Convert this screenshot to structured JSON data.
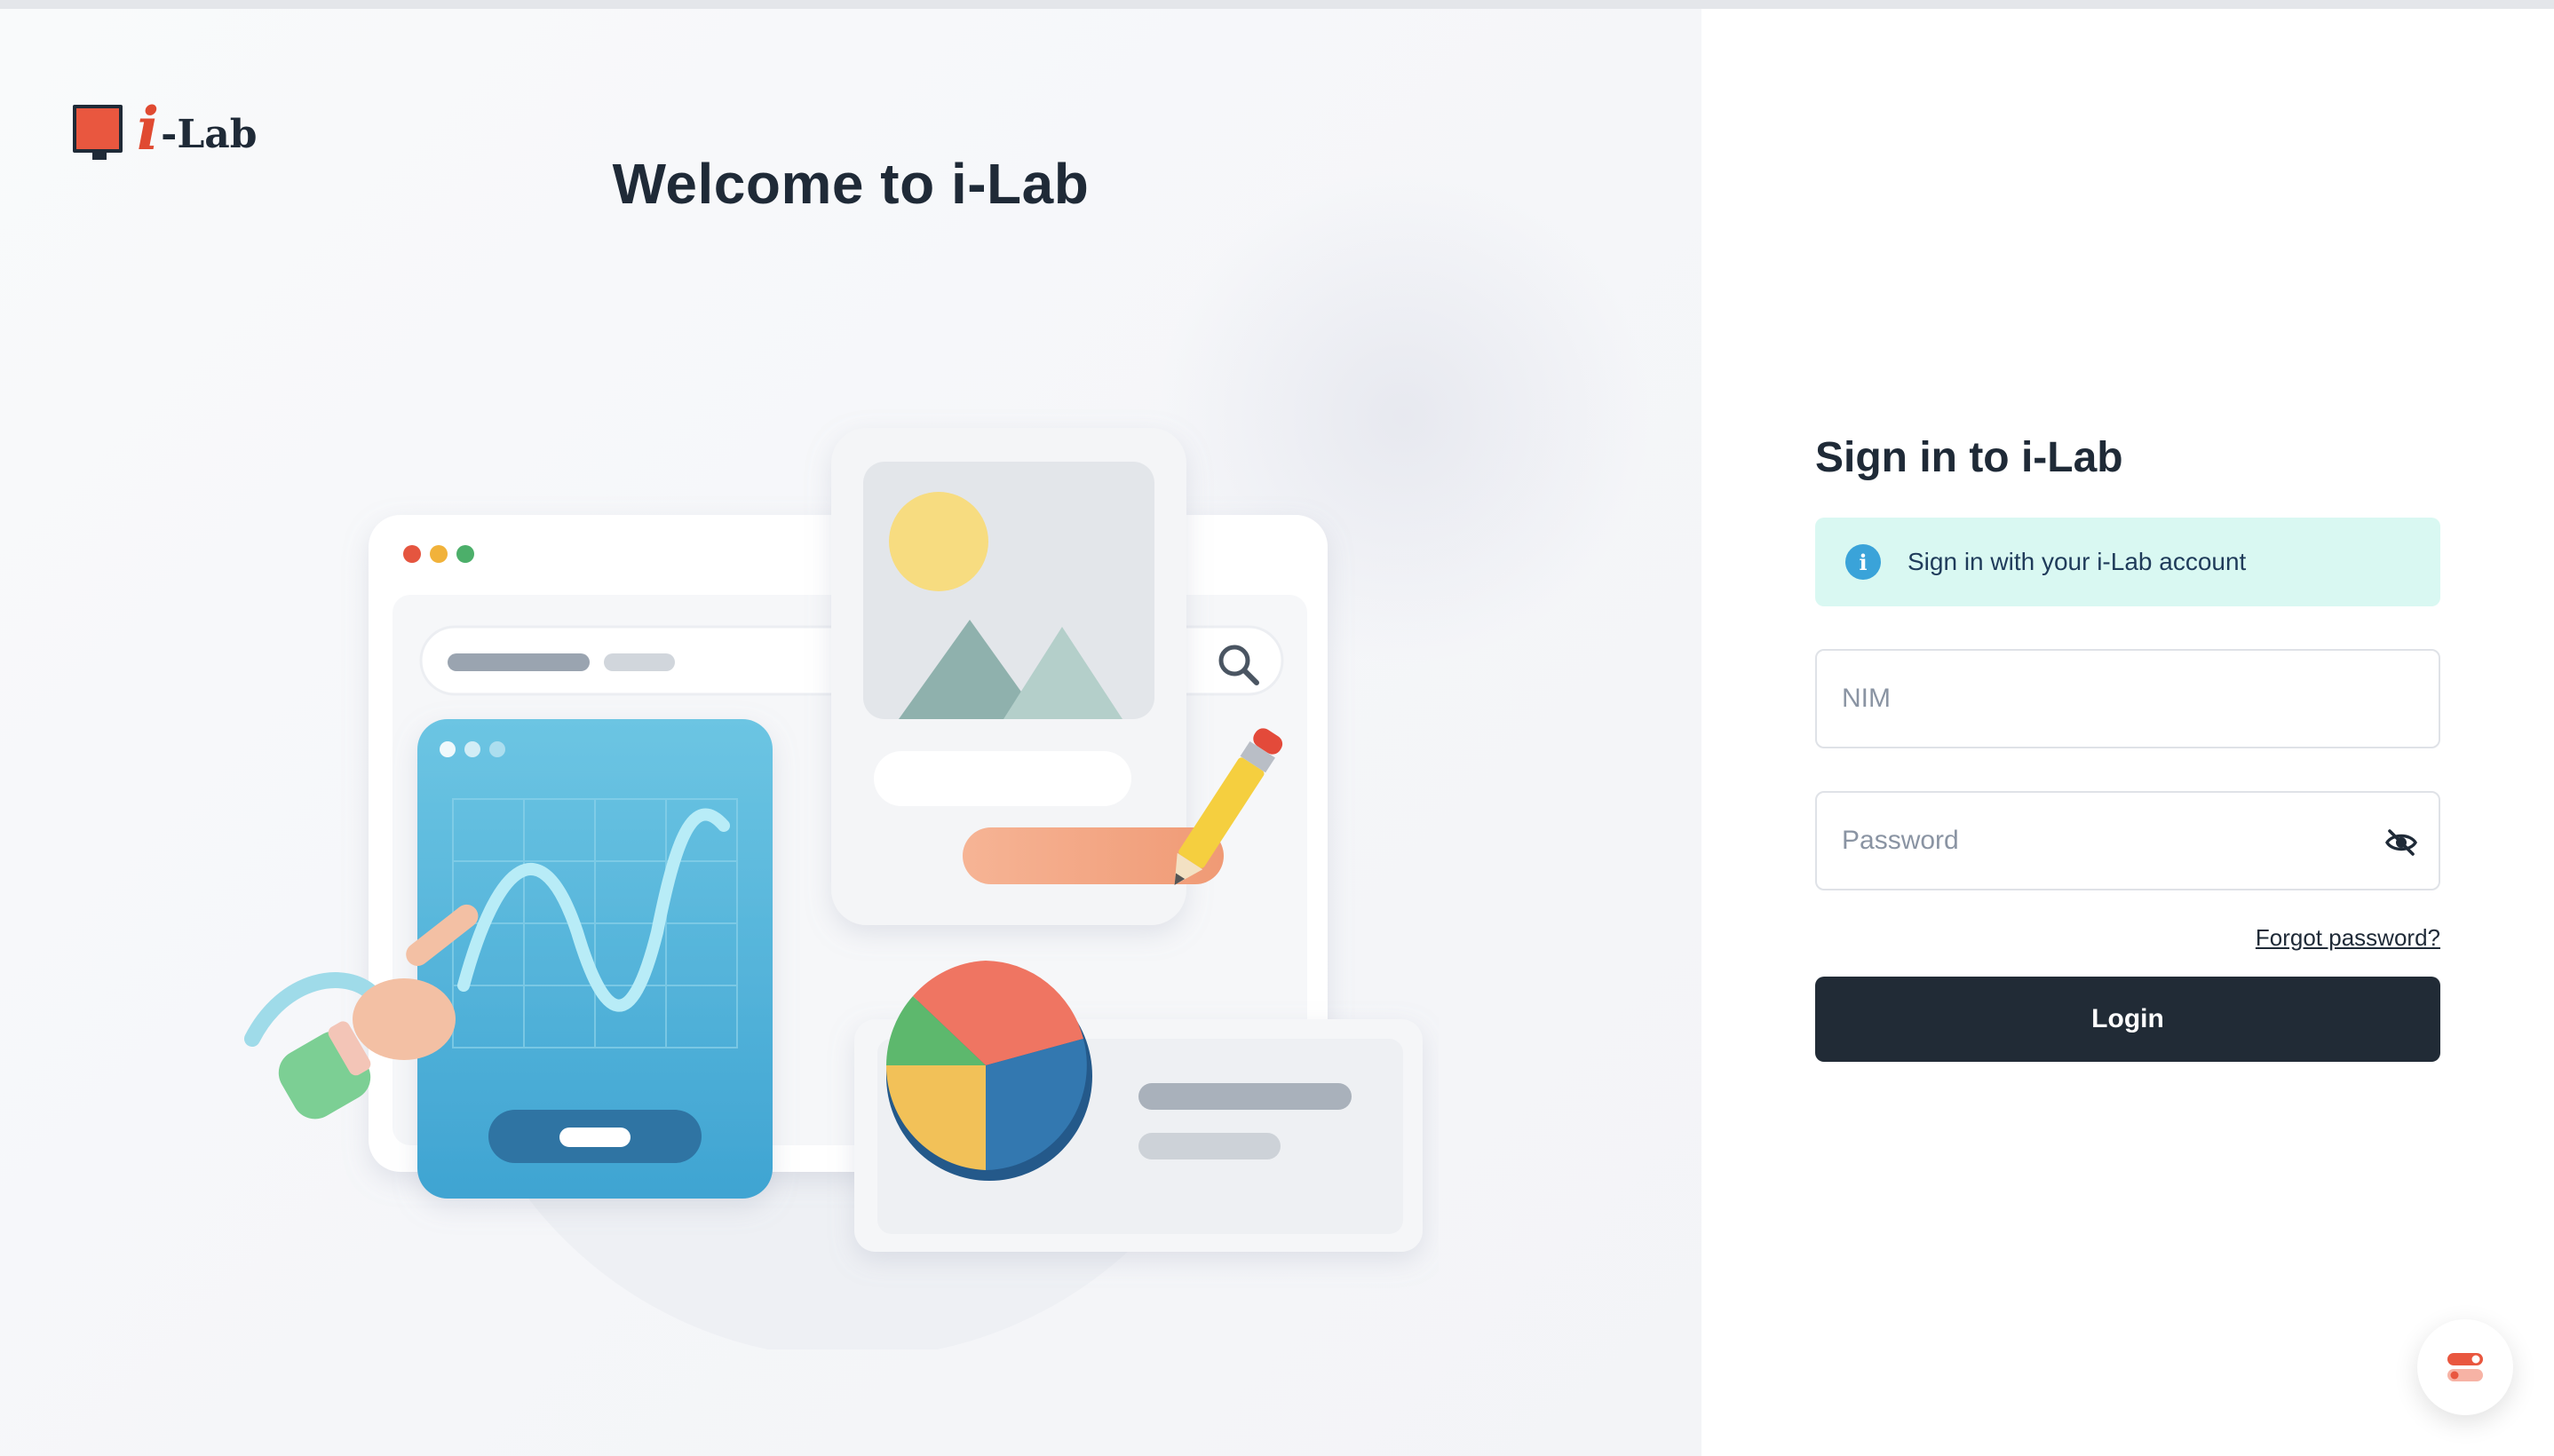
{
  "brand": {
    "logo_i": "i",
    "logo_lab": "-Lab"
  },
  "welcome": {
    "title": "Welcome to i-Lab"
  },
  "signin": {
    "title": "Sign in to i-Lab",
    "info_text": "Sign in with your i-Lab account",
    "nim_placeholder": "NIM",
    "password_placeholder": "Password",
    "forgot_label": "Forgot password?",
    "login_label": "Login"
  },
  "colors": {
    "accent": "#e9573f",
    "dark": "#212b36",
    "info_bg": "#d9f8f2",
    "info_icon": "#3aa3d9"
  },
  "icons": {
    "info": "info-icon",
    "password_toggle": "eye-off-icon",
    "settings": "settings-toggle-icon"
  }
}
